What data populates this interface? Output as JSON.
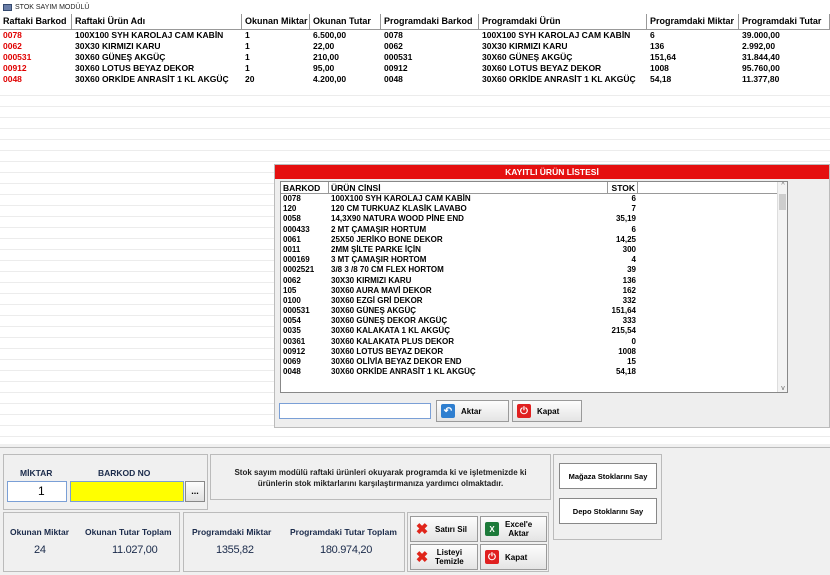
{
  "window": {
    "title": "STOK SAYIM MODÜLÜ",
    "icon": "app-window-icon"
  },
  "grid": {
    "headers": [
      "Raftaki Barkod",
      "Raftaki Ürün Adı",
      "Okunan Miktar",
      "Okunan Tutar",
      "Programdaki Barkod",
      "Programdaki Ürün",
      "Programdaki Miktar",
      "Programdaki Tutar"
    ],
    "rows": [
      [
        "0078",
        "100X100 SYH KAROLAJ CAM KABİN",
        "1",
        "6.500,00",
        "0078",
        "100X100 SYH KAROLAJ CAM KABİN",
        "6",
        "39.000,00"
      ],
      [
        "0062",
        "30X30 KIRMIZI KARU",
        "1",
        "22,00",
        "0062",
        "30X30 KIRMIZI KARU",
        "136",
        "2.992,00"
      ],
      [
        "000531",
        "30X60 GÜNEŞ AKGÜÇ",
        "1",
        "210,00",
        "000531",
        "30X60 GÜNEŞ AKGÜÇ",
        "151,64",
        "31.844,40"
      ],
      [
        "00912",
        "30X60 LOTUS BEYAZ DEKOR",
        "1",
        "95,00",
        "00912",
        "30X60 LOTUS BEYAZ DEKOR",
        "1008",
        "95.760,00"
      ],
      [
        "0048",
        "30X60 ORKİDE ANRASİT 1 KL AKGÜÇ",
        "20",
        "4.200,00",
        "0048",
        "30X60 ORKİDE ANRASİT 1 KL AKGÜÇ",
        "54,18",
        "11.377,80"
      ]
    ],
    "barcode_color": "#e00000"
  },
  "popup": {
    "title": "KAYITLI ÜRÜN LİSTESİ",
    "headers": [
      "BARKOD",
      "ÜRÜN CİNSİ",
      "STOK"
    ],
    "rows": [
      [
        "0078",
        "100X100 SYH KAROLAJ CAM KABİN",
        "6"
      ],
      [
        "120",
        "120 CM TURKUAZ KLASİK LAVABO",
        "7"
      ],
      [
        "0058",
        "14,3X90 NATURA WOOD PİNE END",
        "35,19"
      ],
      [
        "000433",
        "2 MT ÇAMAŞIR HORTUM",
        "6"
      ],
      [
        "0061",
        "25X50 JERİKO BONE DEKOR",
        "14,25"
      ],
      [
        "0011",
        "2MM ŞİLTE PARKE İÇİN",
        "300"
      ],
      [
        "000169",
        "3 MT ÇAMAŞIR HORTOM",
        "4"
      ],
      [
        "0002521",
        "3/8 3 /8 70 CM FLEX HORTOM",
        "39"
      ],
      [
        "0062",
        "30X30 KIRMIZI KARU",
        "136"
      ],
      [
        "105",
        "30X60 AURA MAVİ DEKOR",
        "162"
      ],
      [
        "0100",
        "30X60 EZGİ GRİ DEKOR",
        "332"
      ],
      [
        "000531",
        "30X60 GÜNEŞ AKGÜÇ",
        "151,64"
      ],
      [
        "0054",
        "30X60 GÜNEŞ DEKOR AKGÜÇ",
        "333"
      ],
      [
        "0035",
        "30X60 KALAKATA 1 KL AKGÜÇ",
        "215,54"
      ],
      [
        "00361",
        "30X60 KALAKATA PLUS DEKOR",
        "0"
      ],
      [
        "00912",
        "30X60 LOTUS BEYAZ DEKOR",
        "1008"
      ],
      [
        "0069",
        "30X60 OLİVİA BEYAZ DEKOR END",
        "15"
      ],
      [
        "0048",
        "30X60 ORKİDE ANRASİT 1 KL AKGÜÇ",
        "54,18"
      ]
    ],
    "search_value": "",
    "aktar_label": "Aktar",
    "kapat_label": "Kapat",
    "title_color": "#e51010"
  },
  "bottom": {
    "miktar_label": "MİKTAR",
    "barkod_label": "BARKOD NO",
    "miktar_value": "1",
    "barkod_value": "",
    "dots_label": "...",
    "info_line1": "Stok sayım modülü raftaki ürünleri okuyarak programda ki ve işletmenizde ki",
    "info_line2": "ürünlerin stok miktarlarını karşılaştırmanıza yardımcı olmaktadır.",
    "okunan_miktar_label": "Okunan Miktar",
    "okunan_miktar_value": "24",
    "okunan_tutar_label": "Okunan Tutar Toplam",
    "okunan_tutar_value": "11.027,00",
    "prog_miktar_label": "Programdaki Miktar",
    "prog_miktar_value": "1355,82",
    "prog_tutar_label": "Programdaki Tutar Toplam",
    "prog_tutar_value": "180.974,20",
    "satir_sil": "Satırı Sil",
    "excel_aktar_1": "Excel'e",
    "excel_aktar_2": "Aktar",
    "listeyi_1": "Listeyi",
    "listeyi_2": "Temizle",
    "kapat": "Kapat",
    "magaza_btn": "Mağaza Stoklarını Say",
    "depo_btn": "Depo Stoklarını Say"
  }
}
